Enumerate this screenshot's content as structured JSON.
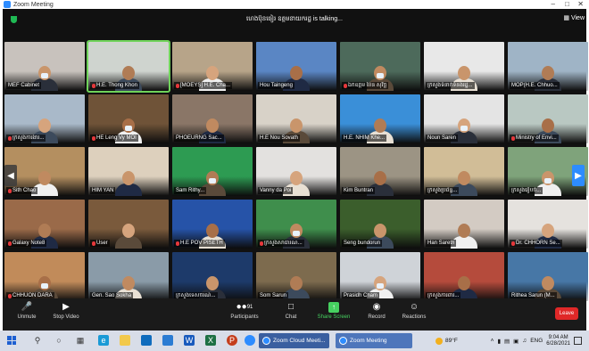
{
  "window": {
    "title": "Zoom Meeting"
  },
  "meeting": {
    "talking_indicator": "ហេងប៊ុនធៀរ ឧត្តមនាយករដ្ឋ is talking...",
    "view_label": "View",
    "participants_count": "91"
  },
  "participants": [
    {
      "name": "MEF Cabinet",
      "muted": false,
      "bg": "#c8c2bd"
    },
    {
      "name": "H.E. Thong Khon",
      "muted": true,
      "bg": "#cfd4cf"
    },
    {
      "name": "[MOEYS] H.E. Cha...",
      "muted": true,
      "bg": "#b7a489"
    },
    {
      "name": "Hou Taingeng",
      "muted": false,
      "bg": "#5a86c4"
    },
    {
      "name": "ឯកឧត្តម ប៉ែន សុវិច្ឆ",
      "muted": true,
      "bg": "#4d6a5b"
    },
    {
      "name": "ក្រសួងទំនាក់ទំនងរដ្ឋ...",
      "muted": false,
      "bg": "#e8e8e8"
    },
    {
      "name": "MOP(H.E. Chhuo...",
      "muted": false,
      "bg": "#9fb4c6"
    },
    {
      "name": "ក្រសួងការងារ...",
      "muted": true,
      "bg": "#a9b9c9"
    },
    {
      "name": "HE Leng Vy MOI",
      "muted": true,
      "bg": "#6f5338"
    },
    {
      "name": "PHOEURNG Sac...",
      "muted": false,
      "bg": "#8a7667"
    },
    {
      "name": "H.E Nou Sovath",
      "muted": false,
      "bg": "#d8d2c8"
    },
    {
      "name": "H.E. NHIM Khe...",
      "muted": false,
      "bg": "#3a8fd8"
    },
    {
      "name": "Noun Saren",
      "muted": false,
      "bg": "#e4e4e4"
    },
    {
      "name": "Ministry of Envi...",
      "muted": true,
      "bg": "#b9c8c2"
    },
    {
      "name": "Sith Chao",
      "muted": true,
      "bg": "#b48f60"
    },
    {
      "name": "HIM YAN",
      "muted": false,
      "bg": "#ddd0bd"
    },
    {
      "name": "Sam Rithy...",
      "muted": false,
      "bg": "#2d9b52"
    },
    {
      "name": "Vanny da Poi",
      "muted": false,
      "bg": "#e3e1df"
    },
    {
      "name": "Kim Buntran",
      "muted": false,
      "bg": "#9c9484"
    },
    {
      "name": "ក្រសួងប្រព័ន្ធ...",
      "muted": false,
      "bg": "#d1bd97"
    },
    {
      "name": "ក្រសួងរៀបចំ...",
      "muted": false,
      "bg": "#7fa37b"
    },
    {
      "name": "Galaxy Note8",
      "muted": true,
      "bg": "#9a6a49"
    },
    {
      "name": "User",
      "muted": true,
      "bg": "#7a5a3c"
    },
    {
      "name": "H.E POV PISETH",
      "muted": true,
      "bg": "#2653a8"
    },
    {
      "name": "ក្រសួងសាធារណ...",
      "muted": true,
      "bg": "#3f8e4c"
    },
    {
      "name": "Seng bundorun",
      "muted": false,
      "bg": "#3b5e2c"
    },
    {
      "name": "Han Sareth",
      "muted": false,
      "bg": "#d3cbc3"
    },
    {
      "name": "Dr. CHHORN Se...",
      "muted": true,
      "bg": "#e5e2de"
    },
    {
      "name": "CHHUON DARA",
      "muted": true,
      "bg": "#c18b5a"
    },
    {
      "name": "Gen. Sao Sokha",
      "muted": false,
      "bg": "#8a9ba8"
    },
    {
      "name": "ក្រសួងទេសចរណ៍...",
      "muted": false,
      "bg": "#1d3a6a"
    },
    {
      "name": "Som Sarun",
      "muted": false,
      "bg": "#7d6b4e"
    },
    {
      "name": "Prasidh Cham",
      "muted": false,
      "bg": "#cfd3d8"
    },
    {
      "name": "ក្រសួងការពារ...",
      "muted": false,
      "bg": "#b54b3c"
    },
    {
      "name": "Rithea Sarun (M...",
      "muted": false,
      "bg": "#4777a6"
    }
  ],
  "toolbar": {
    "unmute": "Unmute",
    "stop_video": "Stop Video",
    "participants": "Participants",
    "chat": "Chat",
    "share_screen": "Share Screen",
    "record": "Record",
    "reactions": "Reactions",
    "leave": "Leave"
  },
  "taskbar": {
    "task1": "Zoom Cloud Meeti...",
    "task2": "Zoom Meeting",
    "weather": "89°F",
    "lang": "ENG",
    "time": "9:04 AM",
    "date": "6/28/2021"
  },
  "colors": {
    "accent": "#2d8cff",
    "active_speaker": "#6fd35a",
    "leave": "#e02828",
    "share": "#46d160"
  }
}
